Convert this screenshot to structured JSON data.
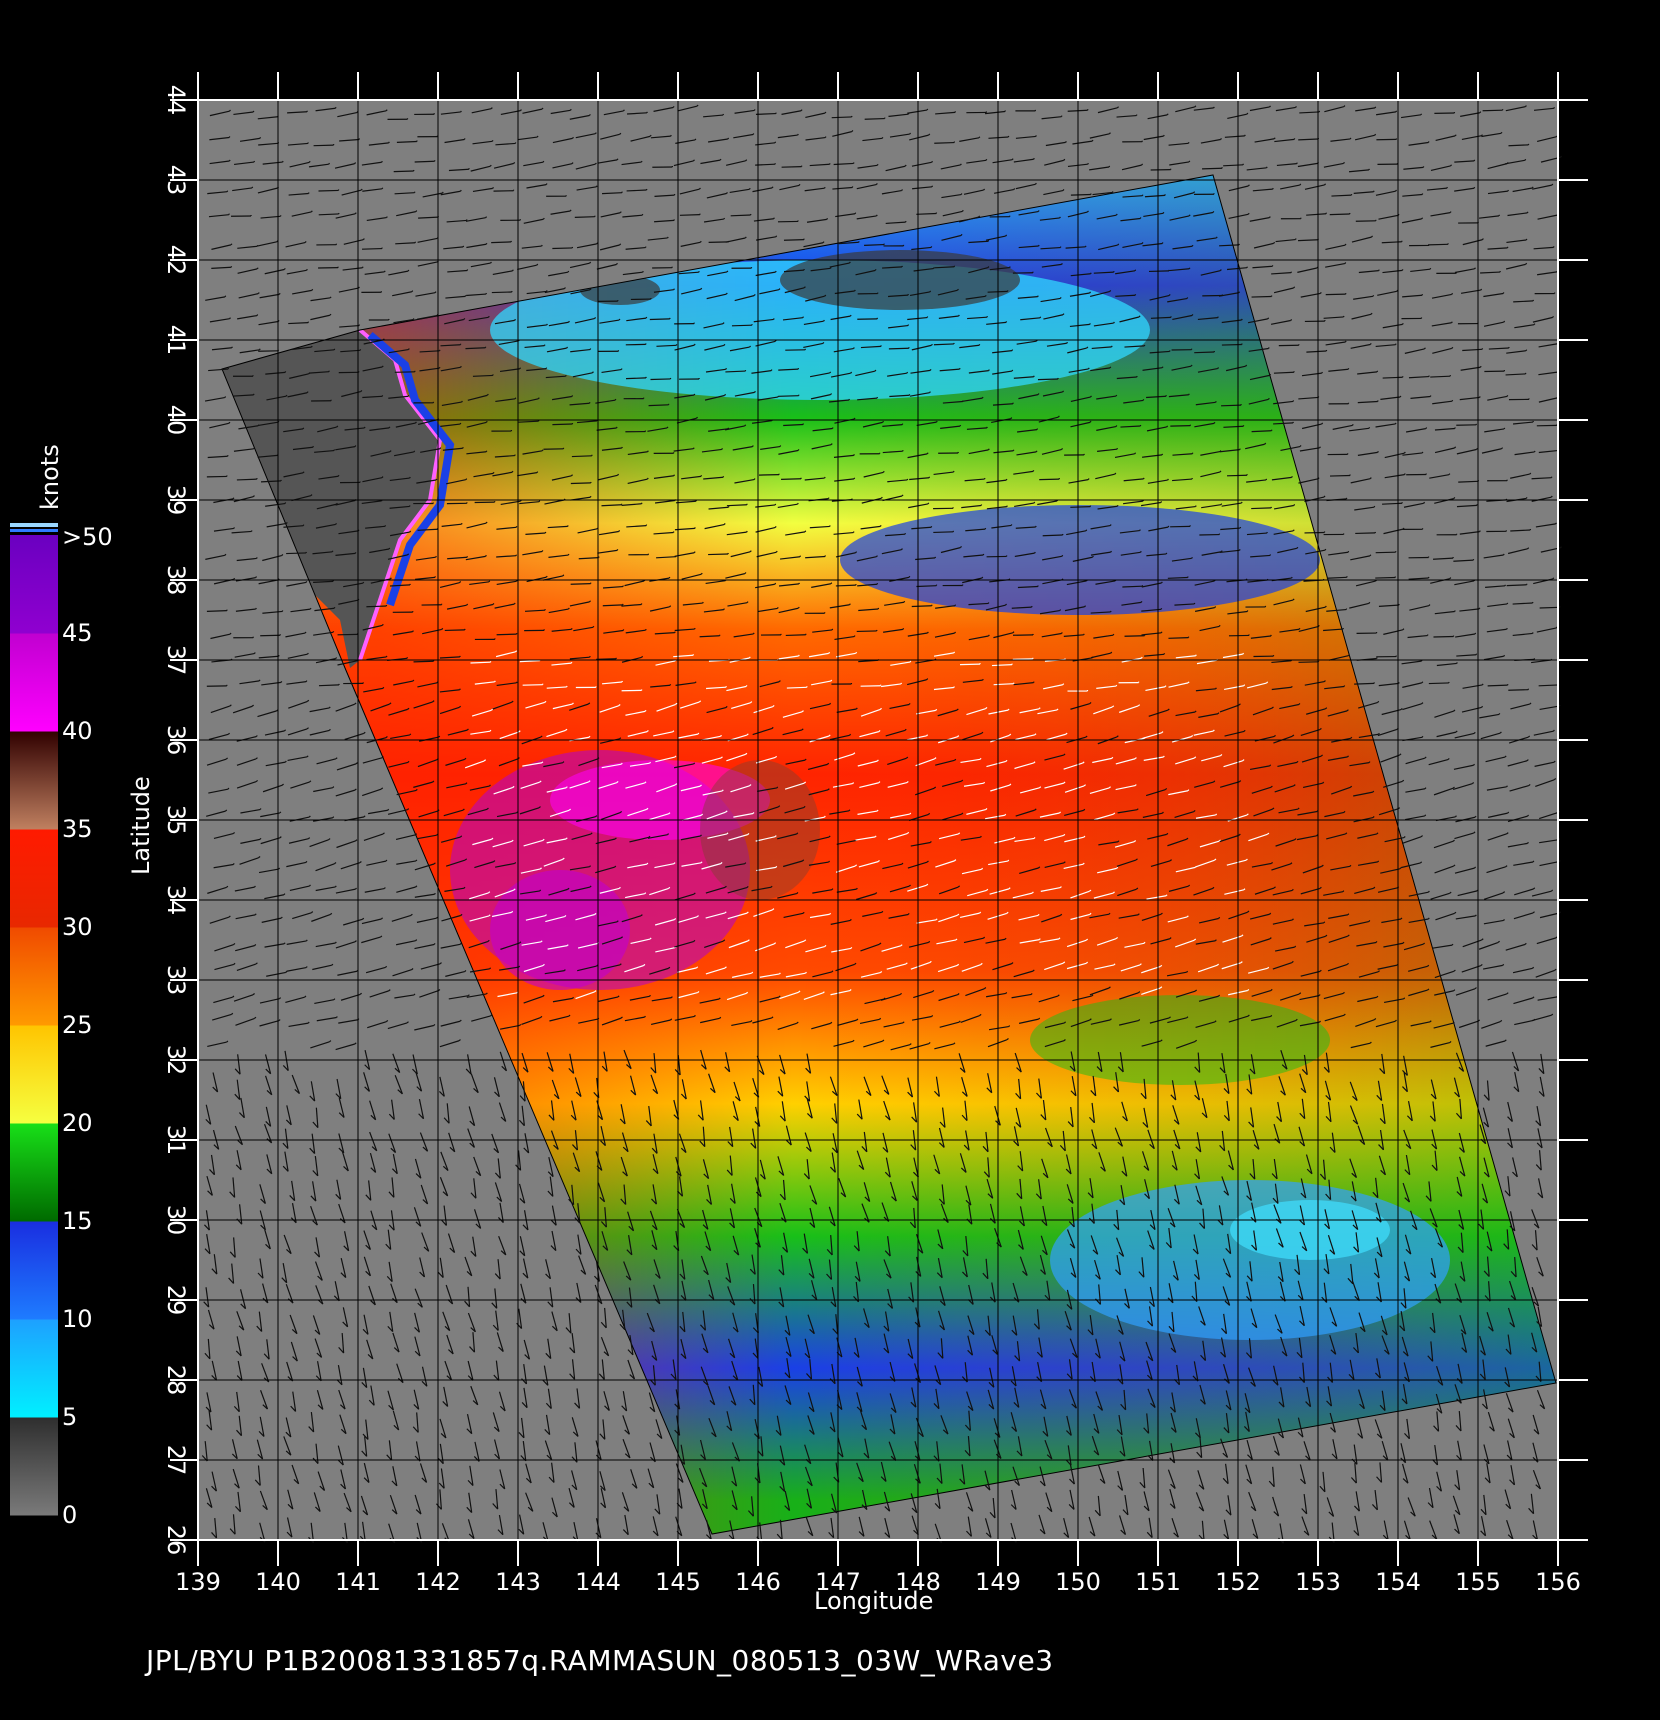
{
  "footer": "JPL/BYU  P1B20081331857q.RAMMASUN_080513_03W_WRave3",
  "axes": {
    "x_title": "Longitude",
    "y_title": "Latitude",
    "x_ticks": [
      "139",
      "140",
      "141",
      "142",
      "143",
      "144",
      "145",
      "146",
      "147",
      "148",
      "149",
      "150",
      "151",
      "152",
      "153",
      "154",
      "155",
      "156"
    ],
    "y_ticks": [
      "26",
      "27",
      "28",
      "29",
      "30",
      "31",
      "32",
      "33",
      "34",
      "35",
      "36",
      "37",
      "38",
      "39",
      "40",
      "41",
      "42",
      "43",
      "44"
    ],
    "xlim": [
      139,
      156
    ],
    "ylim": [
      26,
      44
    ]
  },
  "colorbar": {
    "unit": "knots",
    "labels": [
      "0",
      "5",
      "10",
      "15",
      "20",
      "25",
      "30",
      "35",
      "40",
      "45",
      ">50"
    ],
    "bands": [
      {
        "range": "0-5",
        "colors": [
          "#7a7a7a",
          "#2e2e2e"
        ]
      },
      {
        "range": "5-10",
        "colors": [
          "#00f0ff",
          "#1ea0ff"
        ]
      },
      {
        "range": "10-15",
        "colors": [
          "#1e7cff",
          "#1a2ee0"
        ]
      },
      {
        "range": "15-20",
        "colors": [
          "#006a00",
          "#18e018"
        ]
      },
      {
        "range": "20-25",
        "colors": [
          "#f5ff40",
          "#ffc400"
        ]
      },
      {
        "range": "25-30",
        "colors": [
          "#ff9a00",
          "#f04a00"
        ]
      },
      {
        "range": "30-35",
        "colors": [
          "#e82800",
          "#ff1a00"
        ]
      },
      {
        "range": "35-40",
        "colors": [
          "#c08060",
          "#300000"
        ]
      },
      {
        "range": "40-45",
        "colors": [
          "#ff00ff",
          "#c000d0"
        ]
      },
      {
        "range": "45-50",
        "colors": [
          "#9000d0",
          "#6a00c0"
        ]
      }
    ]
  },
  "colors": {
    "land": "#555555",
    "no_data": "#7f7f7f",
    "grid": "#000000"
  }
}
